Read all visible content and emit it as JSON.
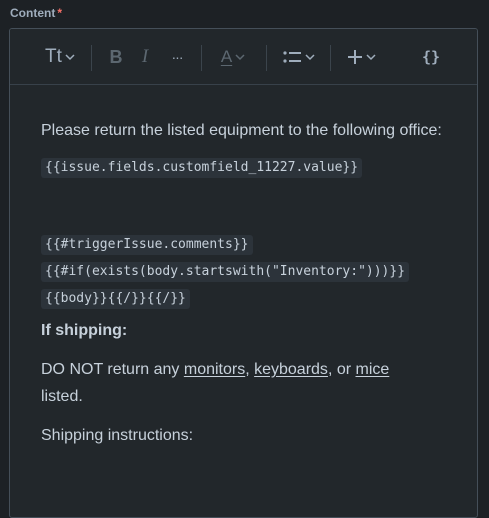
{
  "field": {
    "label": "Content",
    "required_marker": "*"
  },
  "toolbar": {
    "text_style_label": "Tt",
    "bold_label": "B",
    "italic_label": "I",
    "more_label": "···",
    "color_label": "A",
    "code_label": "{}"
  },
  "body": {
    "intro": "Please return the listed equipment to the following office:",
    "code1": "{{issue.fields.customfield_11227.value}}",
    "code2": "{{#triggerIssue.comments}}",
    "code3": "{{#if(exists(body.startswith(\"Inventory:\")))}}",
    "code4": "{{body}}{{/}}{{/}}",
    "shipping_heading": "If shipping:",
    "dont_prefix": "DO NOT return any ",
    "monitors": "monitors",
    "comma1": ", ",
    "keyboards": "keyboards",
    "or_text": ", or ",
    "mice": "mice",
    "listed": "listed.",
    "shipping_instructions": "Shipping instructions:"
  }
}
